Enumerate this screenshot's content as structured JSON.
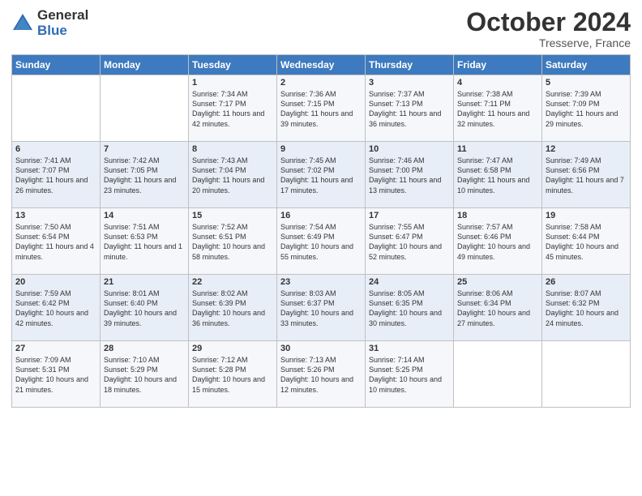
{
  "logo": {
    "general": "General",
    "blue": "Blue"
  },
  "title": "October 2024",
  "location": "Tresserve, France",
  "days_header": [
    "Sunday",
    "Monday",
    "Tuesday",
    "Wednesday",
    "Thursday",
    "Friday",
    "Saturday"
  ],
  "weeks": [
    [
      {
        "day": "",
        "sunrise": "",
        "sunset": "",
        "daylight": ""
      },
      {
        "day": "",
        "sunrise": "",
        "sunset": "",
        "daylight": ""
      },
      {
        "day": "1",
        "sunrise": "Sunrise: 7:34 AM",
        "sunset": "Sunset: 7:17 PM",
        "daylight": "Daylight: 11 hours and 42 minutes."
      },
      {
        "day": "2",
        "sunrise": "Sunrise: 7:36 AM",
        "sunset": "Sunset: 7:15 PM",
        "daylight": "Daylight: 11 hours and 39 minutes."
      },
      {
        "day": "3",
        "sunrise": "Sunrise: 7:37 AM",
        "sunset": "Sunset: 7:13 PM",
        "daylight": "Daylight: 11 hours and 36 minutes."
      },
      {
        "day": "4",
        "sunrise": "Sunrise: 7:38 AM",
        "sunset": "Sunset: 7:11 PM",
        "daylight": "Daylight: 11 hours and 32 minutes."
      },
      {
        "day": "5",
        "sunrise": "Sunrise: 7:39 AM",
        "sunset": "Sunset: 7:09 PM",
        "daylight": "Daylight: 11 hours and 29 minutes."
      }
    ],
    [
      {
        "day": "6",
        "sunrise": "Sunrise: 7:41 AM",
        "sunset": "Sunset: 7:07 PM",
        "daylight": "Daylight: 11 hours and 26 minutes."
      },
      {
        "day": "7",
        "sunrise": "Sunrise: 7:42 AM",
        "sunset": "Sunset: 7:05 PM",
        "daylight": "Daylight: 11 hours and 23 minutes."
      },
      {
        "day": "8",
        "sunrise": "Sunrise: 7:43 AM",
        "sunset": "Sunset: 7:04 PM",
        "daylight": "Daylight: 11 hours and 20 minutes."
      },
      {
        "day": "9",
        "sunrise": "Sunrise: 7:45 AM",
        "sunset": "Sunset: 7:02 PM",
        "daylight": "Daylight: 11 hours and 17 minutes."
      },
      {
        "day": "10",
        "sunrise": "Sunrise: 7:46 AM",
        "sunset": "Sunset: 7:00 PM",
        "daylight": "Daylight: 11 hours and 13 minutes."
      },
      {
        "day": "11",
        "sunrise": "Sunrise: 7:47 AM",
        "sunset": "Sunset: 6:58 PM",
        "daylight": "Daylight: 11 hours and 10 minutes."
      },
      {
        "day": "12",
        "sunrise": "Sunrise: 7:49 AM",
        "sunset": "Sunset: 6:56 PM",
        "daylight": "Daylight: 11 hours and 7 minutes."
      }
    ],
    [
      {
        "day": "13",
        "sunrise": "Sunrise: 7:50 AM",
        "sunset": "Sunset: 6:54 PM",
        "daylight": "Daylight: 11 hours and 4 minutes."
      },
      {
        "day": "14",
        "sunrise": "Sunrise: 7:51 AM",
        "sunset": "Sunset: 6:53 PM",
        "daylight": "Daylight: 11 hours and 1 minute."
      },
      {
        "day": "15",
        "sunrise": "Sunrise: 7:52 AM",
        "sunset": "Sunset: 6:51 PM",
        "daylight": "Daylight: 10 hours and 58 minutes."
      },
      {
        "day": "16",
        "sunrise": "Sunrise: 7:54 AM",
        "sunset": "Sunset: 6:49 PM",
        "daylight": "Daylight: 10 hours and 55 minutes."
      },
      {
        "day": "17",
        "sunrise": "Sunrise: 7:55 AM",
        "sunset": "Sunset: 6:47 PM",
        "daylight": "Daylight: 10 hours and 52 minutes."
      },
      {
        "day": "18",
        "sunrise": "Sunrise: 7:57 AM",
        "sunset": "Sunset: 6:46 PM",
        "daylight": "Daylight: 10 hours and 49 minutes."
      },
      {
        "day": "19",
        "sunrise": "Sunrise: 7:58 AM",
        "sunset": "Sunset: 6:44 PM",
        "daylight": "Daylight: 10 hours and 45 minutes."
      }
    ],
    [
      {
        "day": "20",
        "sunrise": "Sunrise: 7:59 AM",
        "sunset": "Sunset: 6:42 PM",
        "daylight": "Daylight: 10 hours and 42 minutes."
      },
      {
        "day": "21",
        "sunrise": "Sunrise: 8:01 AM",
        "sunset": "Sunset: 6:40 PM",
        "daylight": "Daylight: 10 hours and 39 minutes."
      },
      {
        "day": "22",
        "sunrise": "Sunrise: 8:02 AM",
        "sunset": "Sunset: 6:39 PM",
        "daylight": "Daylight: 10 hours and 36 minutes."
      },
      {
        "day": "23",
        "sunrise": "Sunrise: 8:03 AM",
        "sunset": "Sunset: 6:37 PM",
        "daylight": "Daylight: 10 hours and 33 minutes."
      },
      {
        "day": "24",
        "sunrise": "Sunrise: 8:05 AM",
        "sunset": "Sunset: 6:35 PM",
        "daylight": "Daylight: 10 hours and 30 minutes."
      },
      {
        "day": "25",
        "sunrise": "Sunrise: 8:06 AM",
        "sunset": "Sunset: 6:34 PM",
        "daylight": "Daylight: 10 hours and 27 minutes."
      },
      {
        "day": "26",
        "sunrise": "Sunrise: 8:07 AM",
        "sunset": "Sunset: 6:32 PM",
        "daylight": "Daylight: 10 hours and 24 minutes."
      }
    ],
    [
      {
        "day": "27",
        "sunrise": "Sunrise: 7:09 AM",
        "sunset": "Sunset: 5:31 PM",
        "daylight": "Daylight: 10 hours and 21 minutes."
      },
      {
        "day": "28",
        "sunrise": "Sunrise: 7:10 AM",
        "sunset": "Sunset: 5:29 PM",
        "daylight": "Daylight: 10 hours and 18 minutes."
      },
      {
        "day": "29",
        "sunrise": "Sunrise: 7:12 AM",
        "sunset": "Sunset: 5:28 PM",
        "daylight": "Daylight: 10 hours and 15 minutes."
      },
      {
        "day": "30",
        "sunrise": "Sunrise: 7:13 AM",
        "sunset": "Sunset: 5:26 PM",
        "daylight": "Daylight: 10 hours and 12 minutes."
      },
      {
        "day": "31",
        "sunrise": "Sunrise: 7:14 AM",
        "sunset": "Sunset: 5:25 PM",
        "daylight": "Daylight: 10 hours and 10 minutes."
      },
      {
        "day": "",
        "sunrise": "",
        "sunset": "",
        "daylight": ""
      },
      {
        "day": "",
        "sunrise": "",
        "sunset": "",
        "daylight": ""
      }
    ]
  ]
}
